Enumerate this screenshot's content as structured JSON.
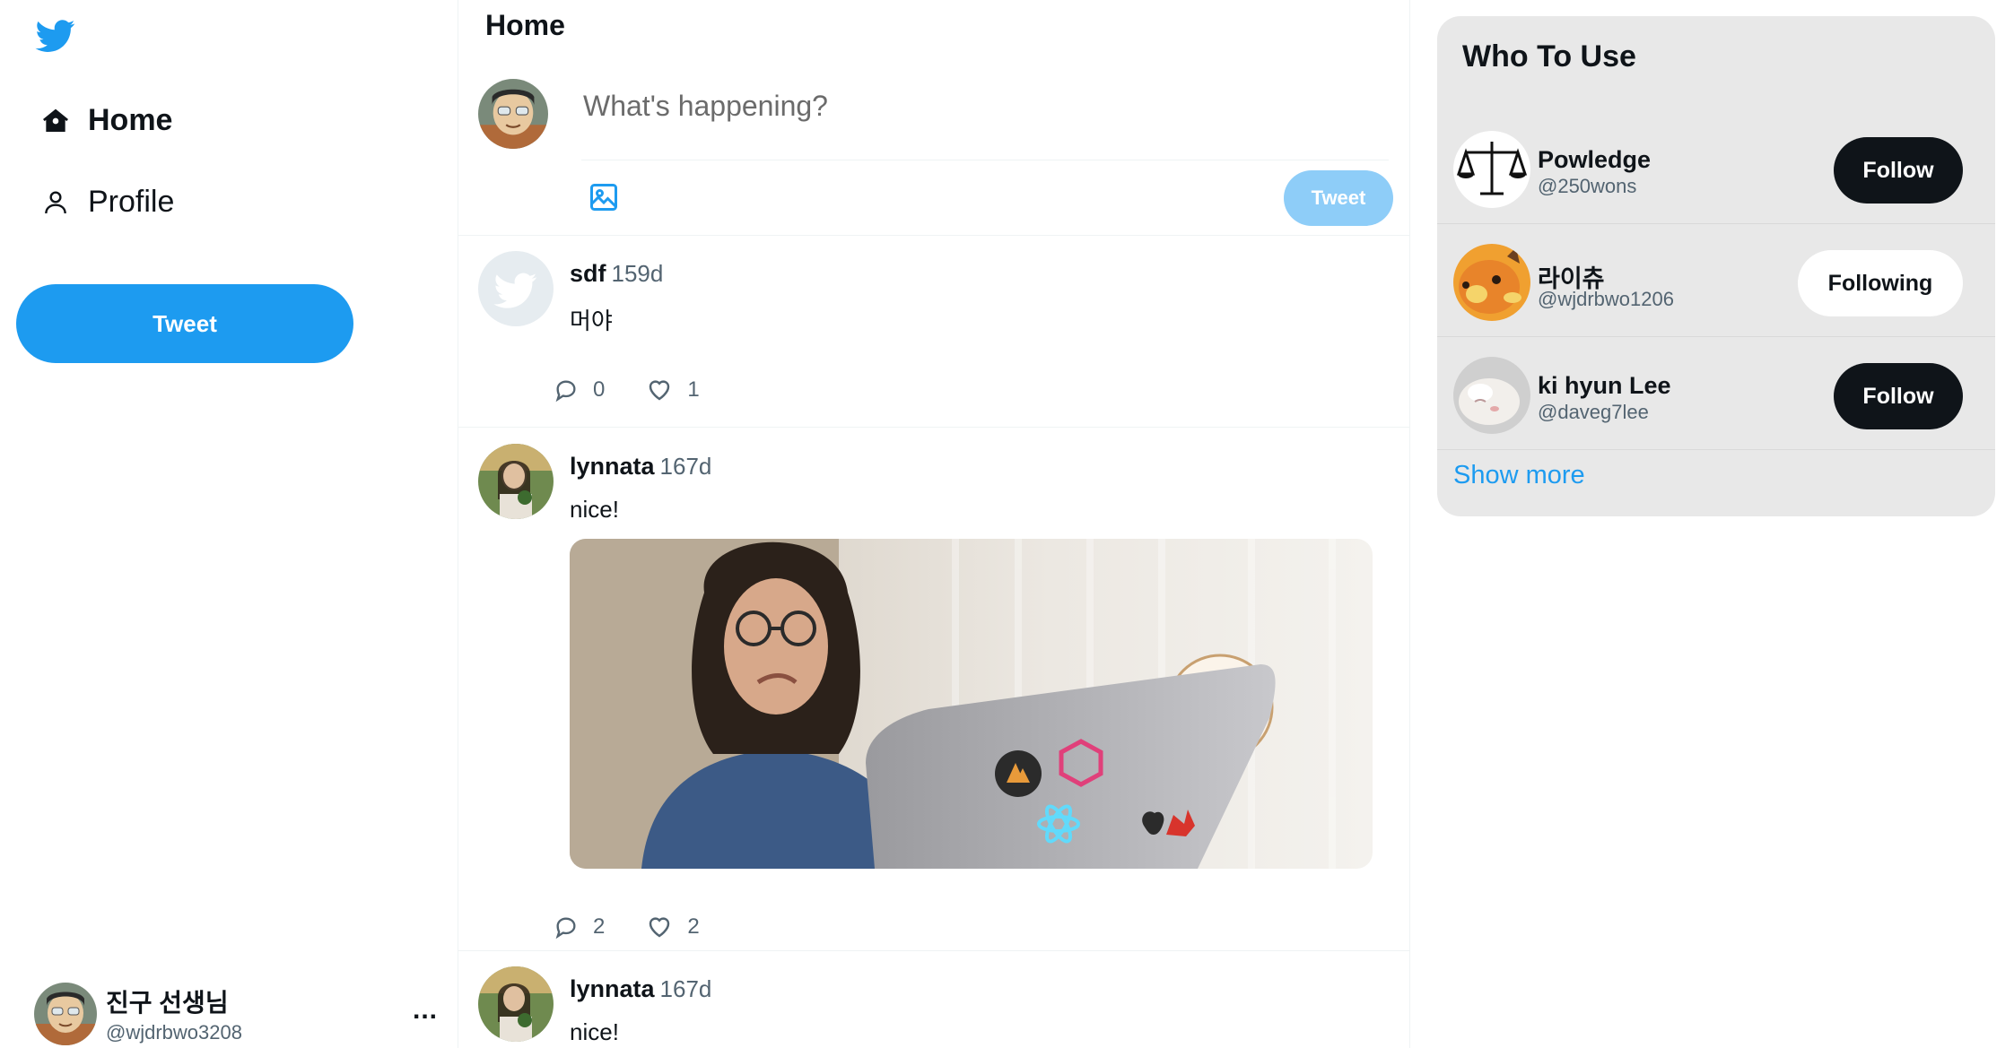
{
  "nav": {
    "items": [
      {
        "label": "Home",
        "icon": "home-icon"
      },
      {
        "label": "Profile",
        "icon": "profile-icon"
      }
    ],
    "tweet_button": "Tweet"
  },
  "account": {
    "display_name": "진구 선생님",
    "handle": "@wjdrbwo3208",
    "more": "..."
  },
  "feed": {
    "title": "Home",
    "compose": {
      "placeholder": "What's happening?",
      "tweet_button": "Tweet"
    },
    "posts": [
      {
        "name": "sdf",
        "time": "159d",
        "text": "머야",
        "replies": "0",
        "likes": "1"
      },
      {
        "name": "lynnata",
        "time": "167d",
        "text": "nice!",
        "replies": "2",
        "likes": "2"
      },
      {
        "name": "lynnata",
        "time": "167d",
        "text": "nice!"
      }
    ]
  },
  "who_to_follow": {
    "title": "Who To Use",
    "users": [
      {
        "name": "Powledge",
        "handle": "@250wons",
        "button": "Follow"
      },
      {
        "name": "라이츄",
        "handle": "@wjdrbwo1206",
        "button": "Following"
      },
      {
        "name": "ki hyun Lee",
        "handle": "@daveg7lee",
        "button": "Follow"
      }
    ],
    "show_more": "Show more"
  },
  "colors": {
    "accent": "#1d9bf0",
    "accent_disabled": "#8ecdf8",
    "text": "#0f1419",
    "muted": "#536471",
    "panel": "#e8e8e8"
  }
}
